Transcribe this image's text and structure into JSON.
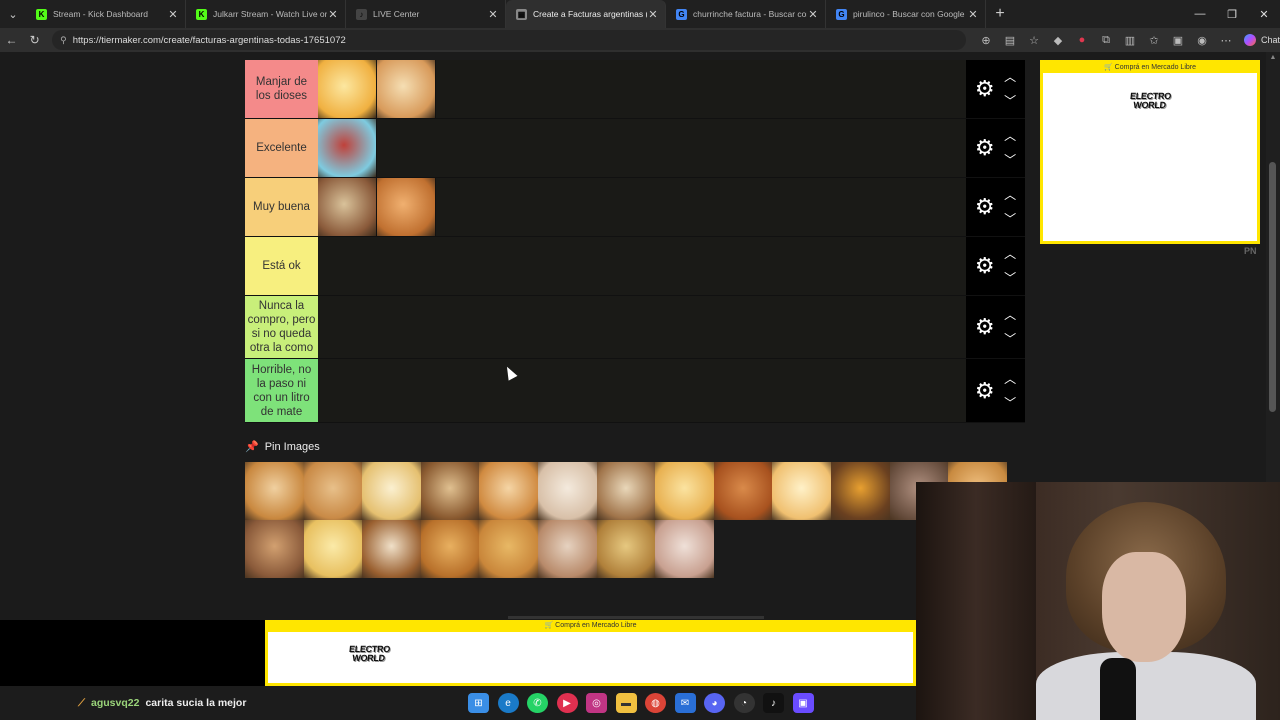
{
  "browser": {
    "tabs": [
      {
        "title": "Stream - Kick Dashboard",
        "fav_color": "#53fc18",
        "fav_glyph": "K",
        "active": false
      },
      {
        "title": "Julkarr Stream - Watch Live on Kick",
        "fav_color": "#53fc18",
        "fav_glyph": "K",
        "active": false
      },
      {
        "title": "LIVE Center",
        "fav_color": "#444444",
        "fav_glyph": "♪",
        "active": false
      },
      {
        "title": "Create a Facturas argentinas (TODAS)",
        "fav_color": "#888888",
        "fav_glyph": "▦",
        "active": true
      },
      {
        "title": "churrinche factura - Buscar con Google",
        "fav_color": "#4285f4",
        "fav_glyph": "G",
        "active": false
      },
      {
        "title": "pirulinco - Buscar con Google",
        "fav_color": "#4285f4",
        "fav_glyph": "G",
        "active": false
      }
    ],
    "url": "https://tiermaker.com/create/facturas-argentinas-todas-17651072",
    "chat_label": "Chat"
  },
  "tiers": [
    {
      "label": "Manjar de los dioses",
      "color": "#f48a8a",
      "items": [
        {
          "c1": "#f0b040",
          "c2": "#fce7a0"
        },
        {
          "c1": "#d89a5a",
          "c2": "#f5deb3"
        }
      ]
    },
    {
      "label": "Excelente",
      "color": "#f5b27f",
      "items": [
        {
          "c1": "#7ecbe0",
          "c2": "#c0413a"
        }
      ]
    },
    {
      "label": "Muy buena",
      "color": "#f7cf7a",
      "items": [
        {
          "c1": "#8a5a3a",
          "c2": "#d9c29a"
        },
        {
          "c1": "#c07030",
          "c2": "#f0b070"
        }
      ]
    },
    {
      "label": "Está ok",
      "color": "#f7ef7f",
      "items": []
    },
    {
      "label": "Nunca la compro, pero si no queda otra la como",
      "color": "#c8ef7a",
      "items": []
    },
    {
      "label": "Horrible, no la paso ni con un litro de mate",
      "color": "#7ee27a",
      "items": []
    }
  ],
  "pin_label": "Pin Images",
  "pool": [
    {
      "c1": "#c9883f",
      "c2": "#f0d0a0"
    },
    {
      "c1": "#c98a46",
      "c2": "#e8c08a"
    },
    {
      "c1": "#e5c070",
      "c2": "#fbf0d0"
    },
    {
      "c1": "#8a5a30",
      "c2": "#e0c090"
    },
    {
      "c1": "#d08a40",
      "c2": "#f5d5a5"
    },
    {
      "c1": "#d8c0a8",
      "c2": "#f4eadd"
    },
    {
      "c1": "#a0744a",
      "c2": "#e9d7b9"
    },
    {
      "c1": "#e8b050",
      "c2": "#fbe3a0"
    },
    {
      "c1": "#a8521f",
      "c2": "#d98a4a"
    },
    {
      "c1": "#f0c070",
      "c2": "#fff1c8"
    },
    {
      "c1": "#6a4020",
      "c2": "#e8a030"
    },
    {
      "c1": "#6a5040",
      "c2": "#b09080"
    },
    {
      "c1": "#c88a40",
      "c2": "#f0c080"
    },
    {
      "c1": "#8a5a3a",
      "c2": "#d2a070"
    },
    {
      "c1": "#e8c060",
      "c2": "#fbeaa8"
    },
    {
      "c1": "#9a6030",
      "c2": "#f0e0c8"
    },
    {
      "c1": "#b8702a",
      "c2": "#e8b060"
    },
    {
      "c1": "#c9863a",
      "c2": "#e8b865"
    },
    {
      "c1": "#b88a6a",
      "c2": "#e6d2c0"
    },
    {
      "c1": "#b0803a",
      "c2": "#e6c880"
    },
    {
      "c1": "#c8a090",
      "c2": "#efe0d8"
    }
  ],
  "ads": {
    "header": "Comprá en Mercado Libre",
    "brand_top": "ELECTRO",
    "brand_bottom": "WORLD",
    "corner_mark": "PN"
  },
  "chat_message": {
    "user": "agusvq22",
    "text": "carita sucia la mejor"
  },
  "colors": {
    "tier_bg": "#1a1a17",
    "control_bg": "#000000",
    "ad_yellow": "#ffe600"
  },
  "icons": {
    "settings": "gear-icon",
    "move_up": "chevron-up-icon",
    "move_down": "chevron-down-icon",
    "pin": "pin-icon"
  }
}
